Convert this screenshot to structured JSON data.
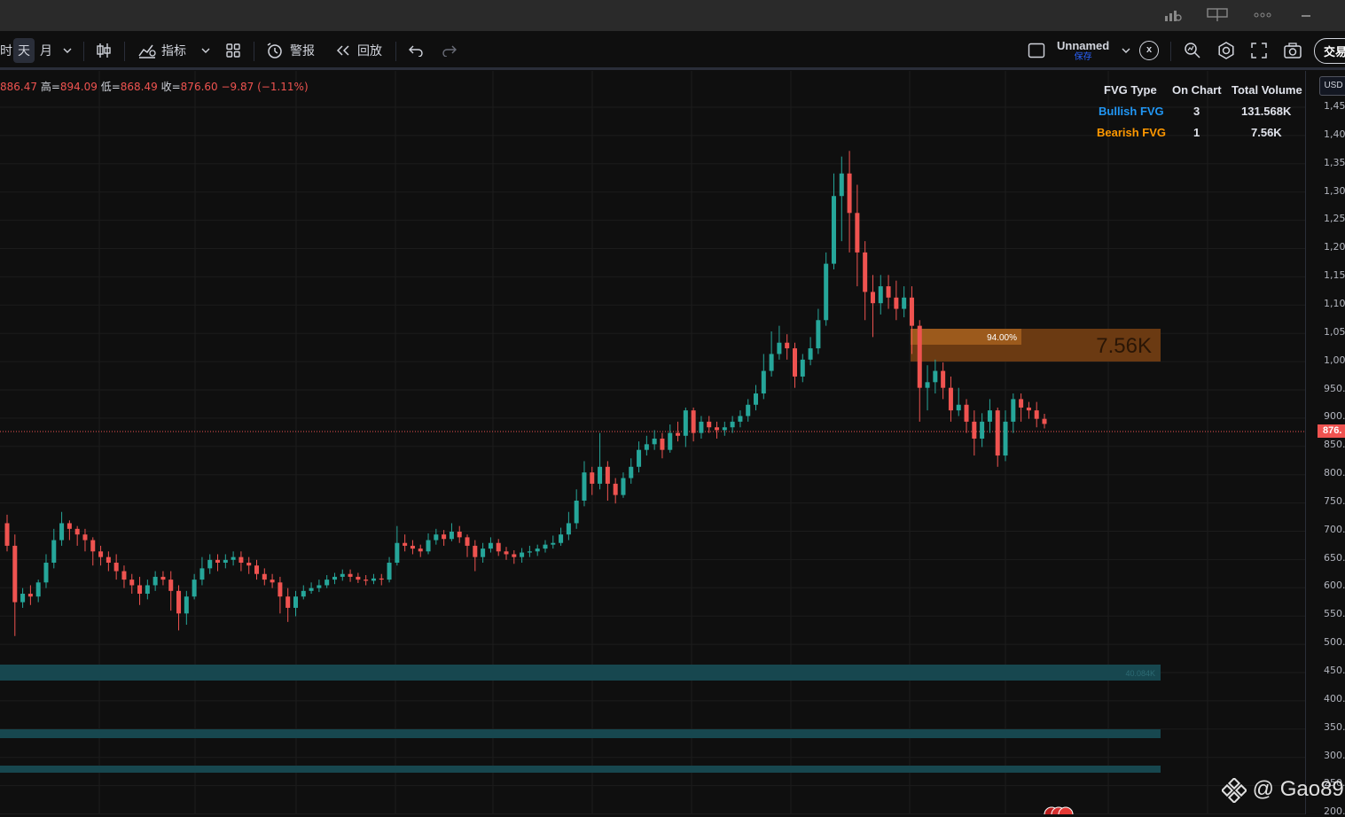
{
  "toolbar": {
    "tf_prev": "时",
    "tf_day": "天",
    "tf_month": "月",
    "indicators": "指标",
    "alerts": "警报",
    "replay": "回放",
    "layout_name": "Unnamed",
    "layout_saved": "保存",
    "close_x": "x",
    "trade": "交易"
  },
  "ohlc": {
    "open_value": "886.47",
    "high_label": "高=",
    "high_value": "894.09",
    "low_label": "低=",
    "low_value": "868.49",
    "close_label": "收=",
    "close_value": "876.60",
    "change": "−9.87 (−1.11%)"
  },
  "fvg_table": {
    "headers": [
      "FVG Type",
      "On Chart",
      "Total Volume"
    ],
    "rows": [
      {
        "type": "Bullish FVG",
        "on_chart": "3",
        "volume": "131.568K",
        "color": "#2196f3"
      },
      {
        "type": "Bearish FVG",
        "on_chart": "1",
        "volume": "7.56K",
        "color": "#ff9800"
      }
    ]
  },
  "bearish_box": {
    "percent": "94.00%",
    "volume": "7.56K"
  },
  "bullish_box_label": "40.084K",
  "price_scale": {
    "currency": "USD",
    "labels": [
      "1,45",
      "1,40",
      "1,35",
      "1,30",
      "1,25",
      "1,20",
      "1,15",
      "1,10",
      "1,05",
      "1,00",
      "950.",
      "900.",
      "850.",
      "800.",
      "750.",
      "700.",
      "650.",
      "600.",
      "550.",
      "500.",
      "450.",
      "400.",
      "350.",
      "300.",
      "250.",
      "200."
    ],
    "current_price": "876."
  },
  "watermark": "@ Gao89",
  "colors": {
    "up": "#26a69a",
    "down": "#ef5350",
    "bearish_fvg": "#8a4a14",
    "bullish_fvg": "#17474f",
    "background": "#0f0f0f"
  },
  "candles": [
    [
      700,
      660,
      715,
      650
    ],
    [
      660,
      560,
      680,
      500
    ],
    [
      560,
      575,
      585,
      550
    ],
    [
      575,
      570,
      590,
      555
    ],
    [
      570,
      595,
      600,
      560
    ],
    [
      595,
      630,
      645,
      585
    ],
    [
      630,
      670,
      690,
      620
    ],
    [
      670,
      700,
      720,
      660
    ],
    [
      700,
      690,
      705,
      670
    ],
    [
      690,
      680,
      695,
      660
    ],
    [
      680,
      670,
      690,
      650
    ],
    [
      670,
      650,
      675,
      625
    ],
    [
      650,
      640,
      660,
      625
    ],
    [
      640,
      630,
      650,
      615
    ],
    [
      630,
      615,
      645,
      600
    ],
    [
      615,
      600,
      625,
      585
    ],
    [
      600,
      590,
      610,
      575
    ],
    [
      590,
      575,
      605,
      555
    ],
    [
      575,
      590,
      600,
      565
    ],
    [
      590,
      605,
      615,
      580
    ],
    [
      605,
      600,
      615,
      590
    ],
    [
      600,
      580,
      615,
      545
    ],
    [
      580,
      540,
      590,
      510
    ],
    [
      540,
      570,
      580,
      520
    ],
    [
      570,
      600,
      610,
      565
    ],
    [
      600,
      620,
      640,
      590
    ],
    [
      620,
      635,
      645,
      610
    ],
    [
      635,
      630,
      645,
      615
    ],
    [
      630,
      635,
      645,
      620
    ],
    [
      635,
      640,
      650,
      625
    ],
    [
      640,
      630,
      650,
      615
    ],
    [
      630,
      625,
      640,
      610
    ],
    [
      625,
      610,
      635,
      600
    ],
    [
      610,
      600,
      620,
      590
    ],
    [
      600,
      595,
      610,
      585
    ],
    [
      595,
      570,
      605,
      540
    ],
    [
      570,
      550,
      585,
      525
    ],
    [
      550,
      570,
      580,
      535
    ],
    [
      570,
      580,
      590,
      565
    ],
    [
      580,
      585,
      595,
      575
    ],
    [
      585,
      590,
      600,
      578
    ],
    [
      590,
      600,
      608,
      585
    ],
    [
      600,
      605,
      612,
      592
    ],
    [
      605,
      610,
      618,
      598
    ],
    [
      610,
      605,
      618,
      596
    ],
    [
      605,
      600,
      612,
      594
    ],
    [
      600,
      598,
      608,
      590
    ],
    [
      598,
      602,
      610,
      592
    ],
    [
      602,
      600,
      610,
      590
    ],
    [
      600,
      630,
      640,
      595
    ],
    [
      630,
      665,
      695,
      625
    ],
    [
      665,
      660,
      680,
      650
    ],
    [
      660,
      655,
      670,
      645
    ],
    [
      655,
      650,
      662,
      640
    ],
    [
      650,
      670,
      682,
      645
    ],
    [
      670,
      680,
      690,
      662
    ],
    [
      680,
      672,
      688,
      660
    ],
    [
      672,
      685,
      700,
      668
    ],
    [
      685,
      675,
      695,
      665
    ],
    [
      675,
      660,
      680,
      640
    ],
    [
      660,
      640,
      670,
      615
    ],
    [
      640,
      655,
      665,
      630
    ],
    [
      655,
      665,
      675,
      648
    ],
    [
      665,
      650,
      672,
      642
    ],
    [
      650,
      645,
      658,
      635
    ],
    [
      645,
      640,
      652,
      628
    ],
    [
      640,
      648,
      656,
      630
    ],
    [
      648,
      650,
      660,
      640
    ],
    [
      650,
      655,
      662,
      642
    ],
    [
      655,
      662,
      670,
      648
    ],
    [
      662,
      665,
      678,
      655
    ],
    [
      665,
      680,
      692,
      660
    ],
    [
      680,
      700,
      720,
      670
    ],
    [
      700,
      740,
      760,
      690
    ],
    [
      740,
      790,
      810,
      730
    ],
    [
      790,
      770,
      800,
      750
    ],
    [
      770,
      800,
      860,
      760
    ],
    [
      800,
      770,
      810,
      740
    ],
    [
      770,
      750,
      780,
      735
    ],
    [
      750,
      780,
      790,
      745
    ],
    [
      780,
      800,
      815,
      770
    ],
    [
      800,
      830,
      845,
      790
    ],
    [
      830,
      840,
      855,
      820
    ],
    [
      840,
      850,
      865,
      830
    ],
    [
      850,
      830,
      860,
      815
    ],
    [
      830,
      860,
      875,
      825
    ],
    [
      860,
      855,
      880,
      845
    ],
    [
      855,
      900,
      905,
      835
    ],
    [
      900,
      860,
      905,
      845
    ],
    [
      860,
      880,
      890,
      850
    ],
    [
      880,
      870,
      890,
      860
    ],
    [
      870,
      865,
      880,
      850
    ],
    [
      865,
      870,
      880,
      855
    ],
    [
      870,
      880,
      890,
      860
    ],
    [
      880,
      890,
      900,
      870
    ],
    [
      890,
      910,
      920,
      880
    ],
    [
      910,
      930,
      945,
      900
    ],
    [
      930,
      970,
      1000,
      920
    ],
    [
      970,
      1000,
      1040,
      960
    ],
    [
      1000,
      1020,
      1050,
      990
    ],
    [
      1020,
      1010,
      1035,
      990
    ],
    [
      1010,
      960,
      1020,
      940
    ],
    [
      960,
      990,
      1000,
      950
    ],
    [
      990,
      1010,
      1030,
      980
    ],
    [
      1010,
      1060,
      1080,
      1000
    ],
    [
      1060,
      1160,
      1180,
      1050
    ],
    [
      1160,
      1280,
      1320,
      1150
    ],
    [
      1280,
      1320,
      1350,
      1200
    ],
    [
      1320,
      1250,
      1360,
      1180
    ],
    [
      1250,
      1180,
      1300,
      1120
    ],
    [
      1180,
      1110,
      1200,
      1060
    ],
    [
      1110,
      1090,
      1140,
      1030
    ],
    [
      1090,
      1120,
      1140,
      1070
    ],
    [
      1120,
      1100,
      1140,
      1080
    ],
    [
      1100,
      1080,
      1130,
      1060
    ],
    [
      1080,
      1100,
      1120,
      1065
    ],
    [
      1100,
      1050,
      1120,
      1000
    ],
    [
      1050,
      940,
      1060,
      880
    ],
    [
      940,
      950,
      980,
      900
    ],
    [
      950,
      970,
      990,
      930
    ],
    [
      970,
      940,
      985,
      920
    ],
    [
      940,
      900,
      960,
      880
    ],
    [
      900,
      910,
      940,
      890
    ],
    [
      910,
      880,
      920,
      860
    ],
    [
      880,
      850,
      900,
      820
    ],
    [
      850,
      880,
      895,
      835
    ],
    [
      880,
      900,
      920,
      860
    ],
    [
      900,
      820,
      905,
      800
    ],
    [
      820,
      880,
      900,
      810
    ],
    [
      880,
      920,
      930,
      860
    ],
    [
      920,
      905,
      930,
      880
    ],
    [
      905,
      900,
      915,
      885
    ],
    [
      900,
      885,
      915,
      870
    ],
    [
      885,
      876,
      894,
      868
    ]
  ]
}
